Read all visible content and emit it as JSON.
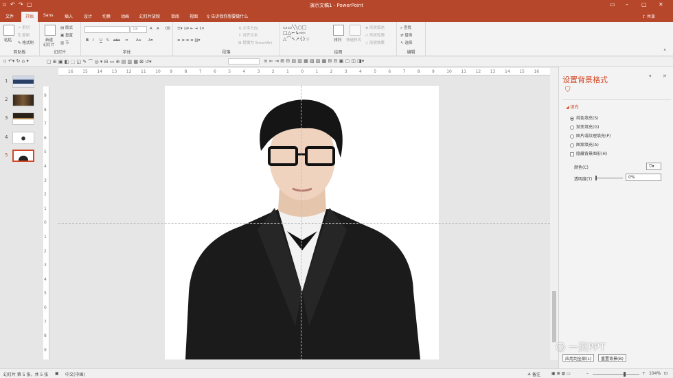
{
  "window": {
    "title": "演示文稿1 - PowerPoint",
    "quick_access": [
      "save-icon",
      "undo-icon",
      "redo-icon",
      "present-icon"
    ],
    "controls": [
      "restore-ribbon-icon",
      "minimize-icon",
      "maximize-icon",
      "close-icon"
    ]
  },
  "tabs": {
    "file": "文件",
    "home": "开始",
    "insert": "插入",
    "design": "设计",
    "transitions": "切换",
    "animations": "动画",
    "slideshow": "幻灯片放映",
    "review": "审阅",
    "view": "视图",
    "telltip": "告诉我你想要做什么",
    "share": "共享",
    "extra": "Sans"
  },
  "ribbon": {
    "clipboard": {
      "label": "剪贴板",
      "paste": "粘贴",
      "cut": "剪切",
      "copy": "复制",
      "format_painter": "格式刷"
    },
    "slides": {
      "label": "幻灯片",
      "new_slide": "新建",
      "new_slide2": "幻灯片",
      "layout": "版式",
      "reset": "重置",
      "section": "节"
    },
    "font": {
      "label": "字体",
      "font_name": "",
      "font_size": "18",
      "bold": "B",
      "italic": "I",
      "underline": "U",
      "shadow": "S",
      "strike": "abc",
      "grow": "A",
      "shrink": "A"
    },
    "paragraph": {
      "label": "段落",
      "text_direction": "文字方向",
      "align_text": "对齐文本",
      "smartart": "转换为 SmartArt"
    },
    "drawing": {
      "label": "绘图",
      "arrange": "排列",
      "quick_styles": "快速样式",
      "shape_fill": "形状填充",
      "shape_outline": "形状轮廓",
      "shape_effects": "形状效果"
    },
    "editing": {
      "label": "编辑",
      "find": "查找",
      "replace": "替换",
      "select": "选择"
    }
  },
  "thumbnails": [
    "1",
    "2",
    "3",
    "4",
    "5"
  ],
  "active_slide": "5",
  "ruler": {
    "h": [
      "16",
      "15",
      "14",
      "13",
      "12",
      "11",
      "10",
      "9",
      "8",
      "7",
      "6",
      "5",
      "4",
      "3",
      "2",
      "1",
      "0",
      "1",
      "2",
      "3",
      "4",
      "5",
      "6",
      "7",
      "8",
      "9",
      "10",
      "11",
      "12",
      "13",
      "14",
      "15",
      "16"
    ],
    "v": [
      "9",
      "8",
      "7",
      "6",
      "5",
      "4",
      "3",
      "2",
      "1",
      "0",
      "1",
      "2",
      "3",
      "4",
      "5",
      "6",
      "7",
      "8",
      "9"
    ]
  },
  "panel": {
    "title": "设置背景格式",
    "section": "填充",
    "options": [
      "纯色填充(S)",
      "渐变填充(G)",
      "图片或纹理填充(P)",
      "图案填充(A)"
    ],
    "selected_option": "纯色填充(S)",
    "hide_bg": "隐藏背景图形(H)",
    "color_label": "颜色(C)",
    "transparency_label": "透明度(T)",
    "transparency_value": "0%",
    "apply_all": "应用到全部(L)",
    "reset_bg": "重置背景(B)"
  },
  "status": {
    "slide_count": "幻灯片 第 5 张，共 5 张",
    "language": "中文(中国)",
    "notes": "备注",
    "zoom": "104%"
  },
  "watermark": "一页PPT",
  "colors": {
    "accent": "#b7472a",
    "orange": "#d24726"
  }
}
